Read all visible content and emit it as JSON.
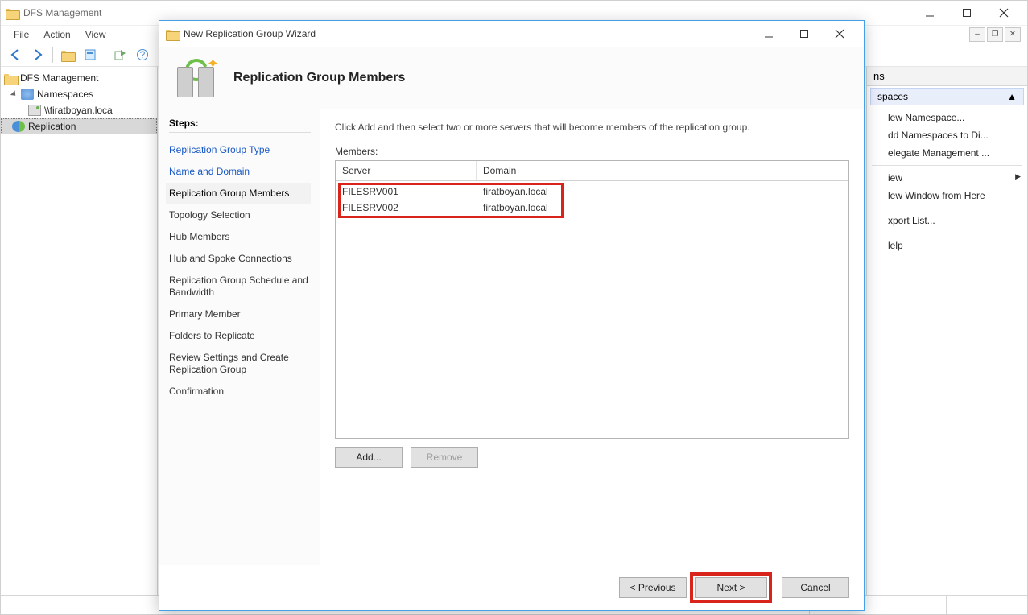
{
  "main": {
    "title": "DFS Management",
    "menu": {
      "file": "File",
      "action": "Action",
      "view": "View"
    }
  },
  "tree": {
    "root": "DFS Management",
    "namespaces": "Namespaces",
    "ns_item": "\\\\firatboyan.loca",
    "replication": "Replication"
  },
  "actions": {
    "header": "ns",
    "section": "spaces",
    "items": {
      "new_ns": "lew Namespace...",
      "add_ns": "dd Namespaces to Di...",
      "delegate": "elegate Management ...",
      "view": "iew",
      "new_win": "lew Window from Here",
      "export": "xport List...",
      "help": "lelp"
    }
  },
  "wizard": {
    "title": "New Replication Group Wizard",
    "heading": "Replication Group Members",
    "steps_label": "Steps:",
    "steps": {
      "type": "Replication Group Type",
      "name": "Name and Domain",
      "members": "Replication Group Members",
      "topology": "Topology Selection",
      "hub": "Hub Members",
      "spoke": "Hub and Spoke Connections",
      "sched": "Replication Group Schedule and Bandwidth",
      "primary": "Primary Member",
      "folders": "Folders to Replicate",
      "review": "Review Settings and Create Replication Group",
      "confirm": "Confirmation"
    },
    "instruction": "Click Add and then select two or more servers that will become members of the replication group.",
    "members_label": "Members:",
    "cols": {
      "server": "Server",
      "domain": "Domain"
    },
    "rows": [
      {
        "server": "FILESRV001",
        "domain": "firatboyan.local"
      },
      {
        "server": "FILESRV002",
        "domain": "firatboyan.local"
      }
    ],
    "buttons": {
      "add": "Add...",
      "remove": "Remove",
      "prev": "< Previous",
      "next": "Next >",
      "cancel": "Cancel"
    }
  }
}
